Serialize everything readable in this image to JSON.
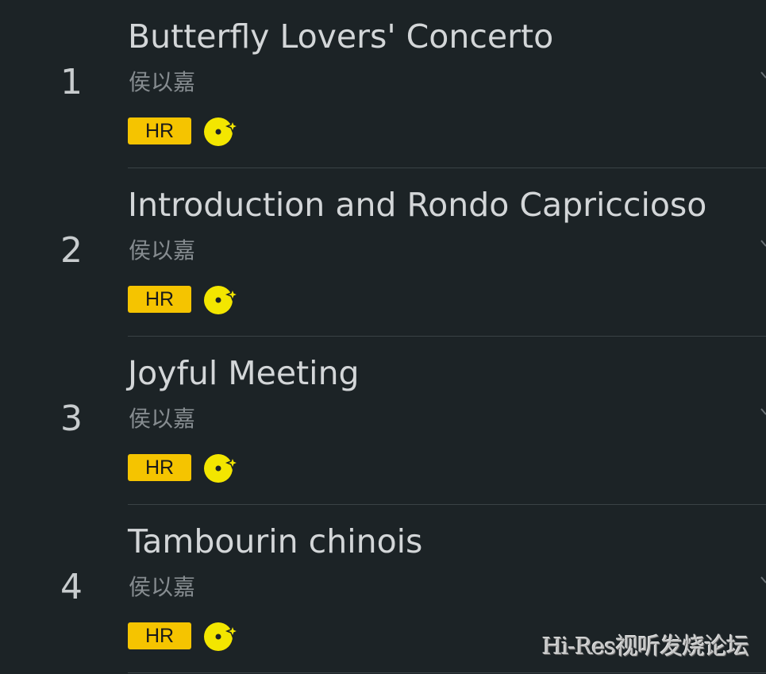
{
  "tracks": [
    {
      "number": "1",
      "title": "Butterfly Lovers' Concerto",
      "artist": "侯以嘉",
      "badge": "HR"
    },
    {
      "number": "2",
      "title": "Introduction and Rondo Capriccioso",
      "artist": "侯以嘉",
      "badge": "HR"
    },
    {
      "number": "3",
      "title": "Joyful Meeting",
      "artist": "侯以嘉",
      "badge": "HR"
    },
    {
      "number": "4",
      "title": "Tambourin chinois",
      "artist": "侯以嘉",
      "badge": "HR"
    }
  ],
  "icons": {
    "quality": "vinyl-sparkle-icon",
    "more": "chevron-icon"
  },
  "colors": {
    "background": "#1c2326",
    "badge": "#f5c400",
    "title": "#d3d6d8",
    "artist": "#868c90"
  },
  "watermark": "Hi-Res视听发烧论坛"
}
